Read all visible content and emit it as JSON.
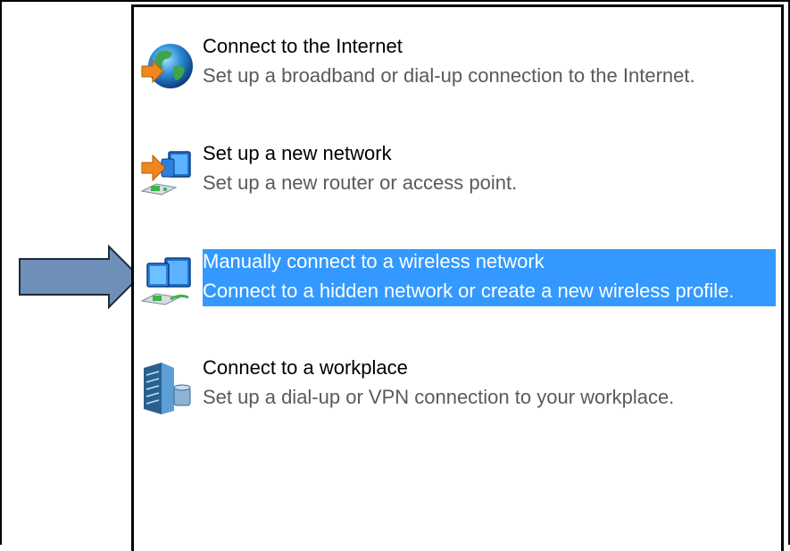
{
  "options": [
    {
      "title": "Connect to the Internet",
      "description": "Set up a broadband or dial-up connection to the Internet.",
      "icon": "globe-connect-icon",
      "selected": false
    },
    {
      "title": "Set up a new network",
      "description": "Set up a new router or access point.",
      "icon": "new-network-icon",
      "selected": false
    },
    {
      "title": "Manually connect to a wireless network",
      "description": "Connect to a hidden network or create a new wireless profile.",
      "icon": "wireless-network-icon",
      "selected": true
    },
    {
      "title": "Connect to a workplace",
      "description": "Set up a dial-up or VPN connection to your workplace.",
      "icon": "workplace-building-icon",
      "selected": false
    }
  ],
  "colors": {
    "selection": "#3399ff",
    "description_text": "#5a5a5a",
    "arrow_fill": "#6d8fb8"
  }
}
